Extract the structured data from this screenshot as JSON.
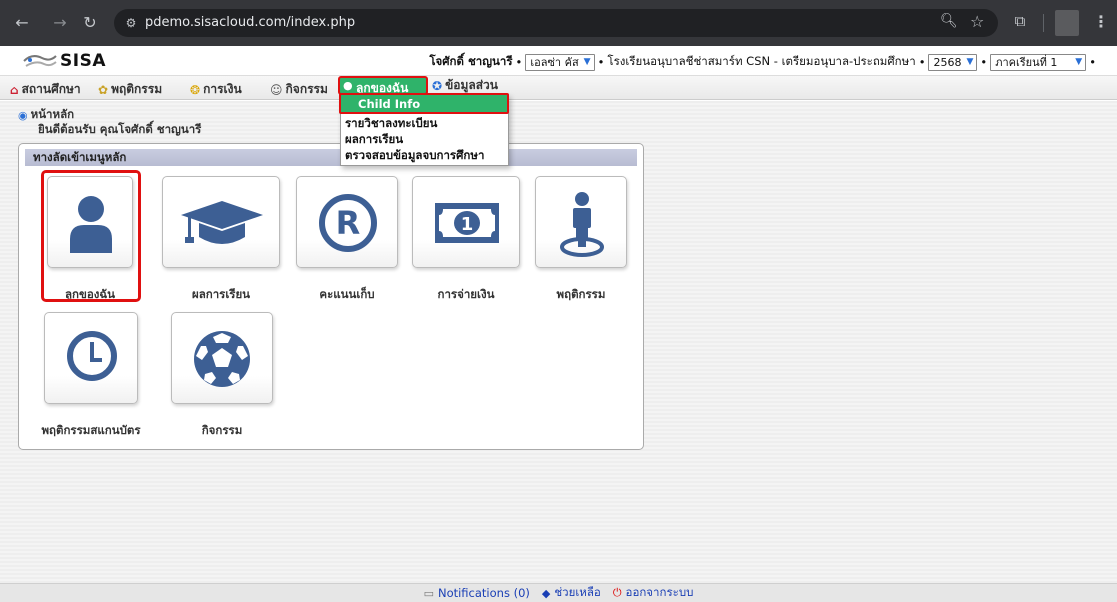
{
  "browser": {
    "url": "pdemo.sisacloud.com/index.php"
  },
  "header": {
    "logo_text": "SISA",
    "user_name": "โจศักดิ์ ชาญนารี",
    "child_select": "เอลซ่า คัส",
    "school": "โรงเรียนอนุบาลชีช่าสมาร์ท CSN - เตรียมอนุบาล-ประถมศึกษา",
    "year_select": "2568",
    "term_select": "ภาคเรียนที่ 1",
    "bullet": "•"
  },
  "menubar": {
    "items": [
      {
        "label": "สถานศึกษา"
      },
      {
        "label": "พฤติกรรม"
      },
      {
        "label": "การเงิน"
      },
      {
        "label": "กิจกรรม"
      },
      {
        "label": "ลูกของฉัน"
      },
      {
        "label": "ข้อมูลส่วน"
      }
    ]
  },
  "dropdown": {
    "items": [
      {
        "label": "Child Info"
      },
      {
        "label": "รายวิชาลงทะเบียน"
      },
      {
        "label": "ผลการเรียน"
      },
      {
        "label": "ตรวจสอบข้อมูลจบการศึกษา"
      }
    ]
  },
  "breadcrumb": {
    "home": "หน้าหลัก",
    "welcome": "ยินดีต้อนรับ คุณโจศักดิ์ ชาญนารี"
  },
  "panel": {
    "title": "ทางลัดเข้าเมนูหลัก",
    "tiles": [
      {
        "label": "ลูกของฉัน",
        "icon": "person-icon"
      },
      {
        "label": "ผลการเรียน",
        "icon": "graduation-cap-icon"
      },
      {
        "label": "คะแนนเก็บ",
        "icon": "registered-icon"
      },
      {
        "label": "การจ่ายเงิน",
        "icon": "banknote-icon"
      },
      {
        "label": "พฤติกรรม",
        "icon": "person-pin-icon"
      },
      {
        "label": "พฤติกรรมสแกนบัตร",
        "icon": "clock-icon"
      },
      {
        "label": "กิจกรรม",
        "icon": "soccer-ball-icon"
      }
    ]
  },
  "footer": {
    "notifications": "Notifications (0)",
    "help": "ช่วยเหลือ",
    "logout": "ออกจากระบบ"
  },
  "colors": {
    "accent_green": "#2fb36a",
    "highlight_red": "#e01010",
    "icon_blue": "#3d5f94",
    "link_blue": "#1a3fb5"
  }
}
